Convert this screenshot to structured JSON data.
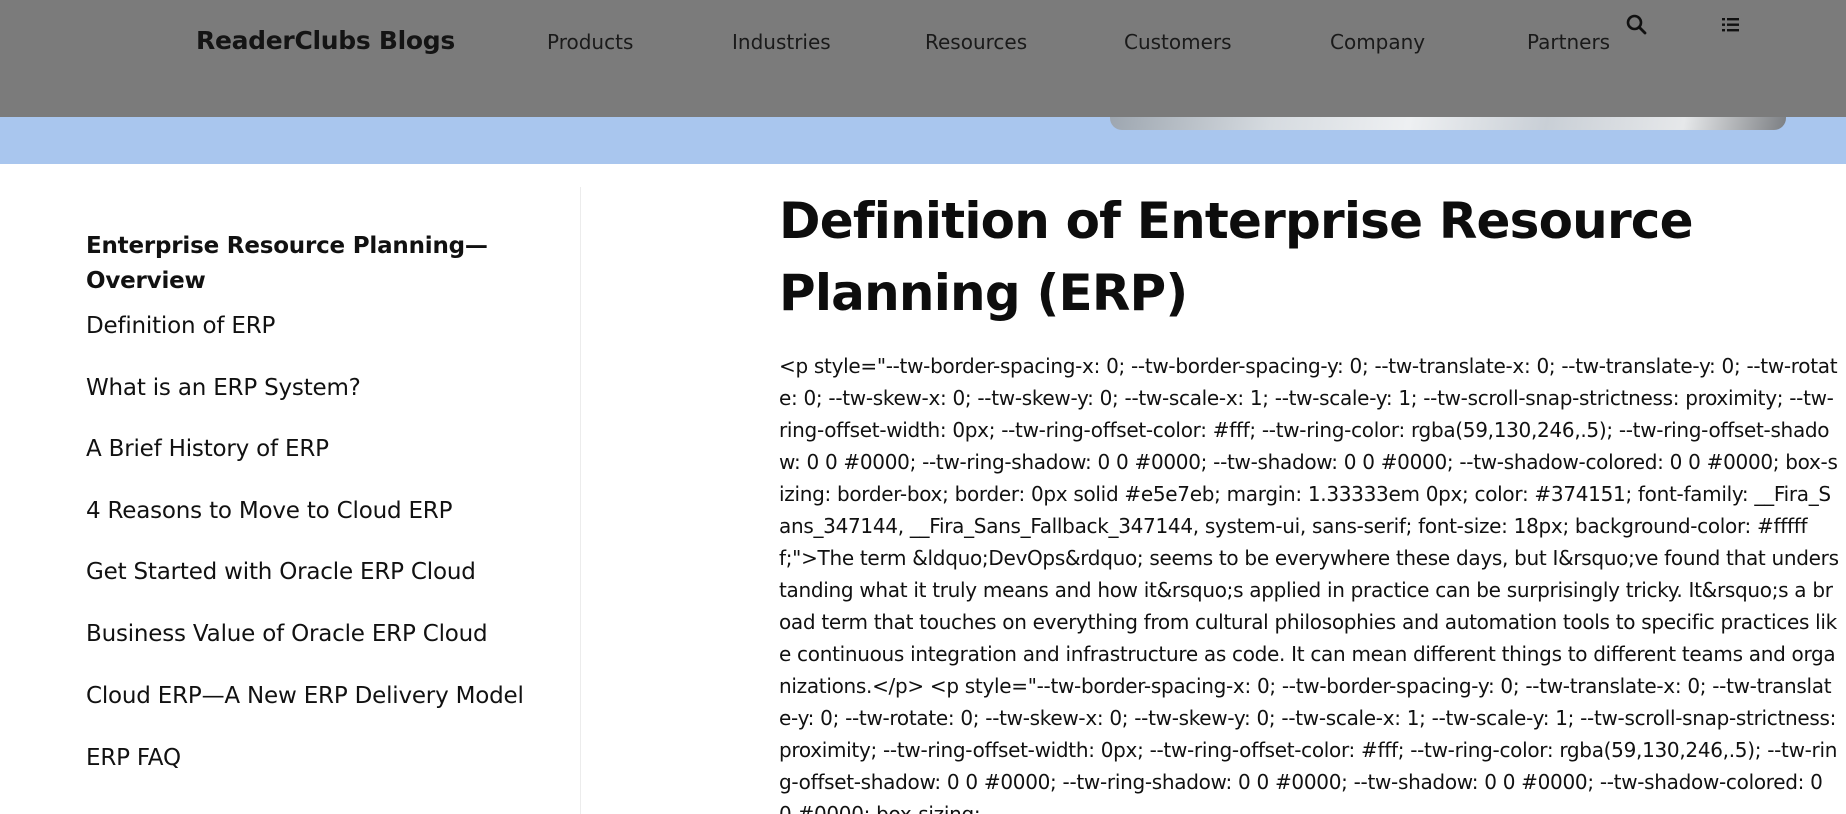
{
  "header": {
    "brand": "ReaderClubs Blogs",
    "nav": [
      "Products",
      "Industries",
      "Resources",
      "Customers",
      "Company",
      "Partners"
    ],
    "icons": {
      "search": "search-icon",
      "menu": "list-menu-icon"
    }
  },
  "colors": {
    "header_bg": "#7b7b7b",
    "hero_band": "#a9c6ee",
    "text": "#111111"
  },
  "sidebar": {
    "current": "Enterprise Resource Planning—Overview",
    "items": [
      "Definition of ERP",
      "What is an ERP System?",
      "A Brief History of ERP",
      "4 Reasons to Move to Cloud ERP",
      "Get Started with Oracle ERP Cloud",
      "Business Value of Oracle ERP Cloud",
      "Cloud ERP—A New ERP Delivery Model",
      "ERP FAQ"
    ]
  },
  "article": {
    "title": "Definition of Enterprise Resource Planning (ERP)",
    "body": "<p style=\"--tw-border-spacing-x: 0; --tw-border-spacing-y: 0; --tw-translate-x: 0; --tw-translate-y: 0; --tw-rotate: 0; --tw-skew-x: 0; --tw-skew-y: 0; --tw-scale-x: 1; --tw-scale-y: 1; --tw-scroll-snap-strictness: proximity; --tw-ring-offset-width: 0px; --tw-ring-offset-color: #fff; --tw-ring-color: rgba(59,130,246,.5); --tw-ring-offset-shadow: 0 0 #0000; --tw-ring-shadow: 0 0 #0000; --tw-shadow: 0 0 #0000; --tw-shadow-colored: 0 0 #0000; box-sizing: border-box; border: 0px solid #e5e7eb; margin: 1.33333em 0px; color: #374151; font-family: __Fira_Sans_347144, __Fira_Sans_Fallback_347144, system-ui, sans-serif; font-size: 18px; background-color: #ffffff;\">The term &ldquo;DevOps&rdquo; seems to be everywhere these days, but I&rsquo;ve found that understanding what it truly means and how it&rsquo;s applied in practice can be surprisingly tricky. It&rsquo;s a broad term that touches on everything from cultural philosophies and automation tools to specific practices like continuous integration and infrastructure as code. It can mean different things to different teams and organizations.</p> <p style=\"--tw-border-spacing-x: 0; --tw-border-spacing-y: 0; --tw-translate-x: 0; --tw-translate-y: 0; --tw-rotate: 0; --tw-skew-x: 0; --tw-skew-y: 0; --tw-scale-x: 1; --tw-scale-y: 1; --tw-scroll-snap-strictness: proximity; --tw-ring-offset-width: 0px; --tw-ring-offset-color: #fff; --tw-ring-color: rgba(59,130,246,.5); --tw-ring-offset-shadow: 0 0 #0000; --tw-ring-shadow: 0 0 #0000; --tw-shadow: 0 0 #0000; --tw-shadow-colored: 0 0 #0000; box-sizing:"
  }
}
